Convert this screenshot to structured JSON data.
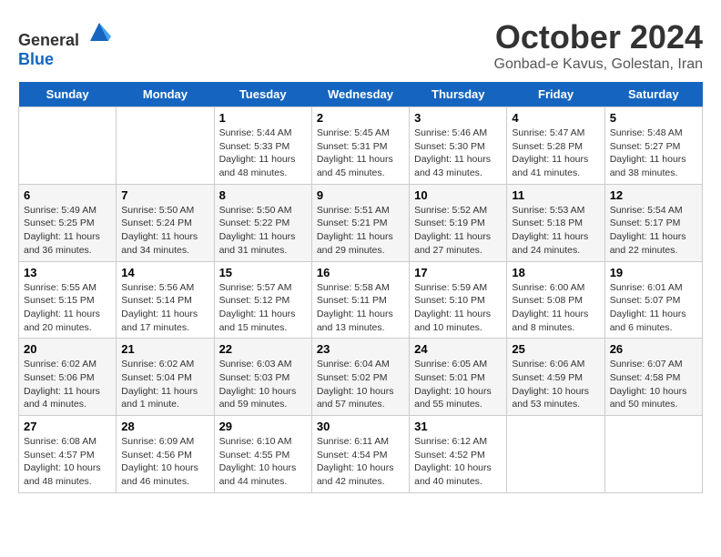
{
  "header": {
    "logo_general": "General",
    "logo_blue": "Blue",
    "month": "October 2024",
    "location": "Gonbad-e Kavus, Golestan, Iran"
  },
  "days_of_week": [
    "Sunday",
    "Monday",
    "Tuesday",
    "Wednesday",
    "Thursday",
    "Friday",
    "Saturday"
  ],
  "weeks": [
    [
      {
        "day": "",
        "sunrise": "",
        "sunset": "",
        "daylight": ""
      },
      {
        "day": "",
        "sunrise": "",
        "sunset": "",
        "daylight": ""
      },
      {
        "day": "1",
        "sunrise": "Sunrise: 5:44 AM",
        "sunset": "Sunset: 5:33 PM",
        "daylight": "Daylight: 11 hours and 48 minutes."
      },
      {
        "day": "2",
        "sunrise": "Sunrise: 5:45 AM",
        "sunset": "Sunset: 5:31 PM",
        "daylight": "Daylight: 11 hours and 45 minutes."
      },
      {
        "day": "3",
        "sunrise": "Sunrise: 5:46 AM",
        "sunset": "Sunset: 5:30 PM",
        "daylight": "Daylight: 11 hours and 43 minutes."
      },
      {
        "day": "4",
        "sunrise": "Sunrise: 5:47 AM",
        "sunset": "Sunset: 5:28 PM",
        "daylight": "Daylight: 11 hours and 41 minutes."
      },
      {
        "day": "5",
        "sunrise": "Sunrise: 5:48 AM",
        "sunset": "Sunset: 5:27 PM",
        "daylight": "Daylight: 11 hours and 38 minutes."
      }
    ],
    [
      {
        "day": "6",
        "sunrise": "Sunrise: 5:49 AM",
        "sunset": "Sunset: 5:25 PM",
        "daylight": "Daylight: 11 hours and 36 minutes."
      },
      {
        "day": "7",
        "sunrise": "Sunrise: 5:50 AM",
        "sunset": "Sunset: 5:24 PM",
        "daylight": "Daylight: 11 hours and 34 minutes."
      },
      {
        "day": "8",
        "sunrise": "Sunrise: 5:50 AM",
        "sunset": "Sunset: 5:22 PM",
        "daylight": "Daylight: 11 hours and 31 minutes."
      },
      {
        "day": "9",
        "sunrise": "Sunrise: 5:51 AM",
        "sunset": "Sunset: 5:21 PM",
        "daylight": "Daylight: 11 hours and 29 minutes."
      },
      {
        "day": "10",
        "sunrise": "Sunrise: 5:52 AM",
        "sunset": "Sunset: 5:19 PM",
        "daylight": "Daylight: 11 hours and 27 minutes."
      },
      {
        "day": "11",
        "sunrise": "Sunrise: 5:53 AM",
        "sunset": "Sunset: 5:18 PM",
        "daylight": "Daylight: 11 hours and 24 minutes."
      },
      {
        "day": "12",
        "sunrise": "Sunrise: 5:54 AM",
        "sunset": "Sunset: 5:17 PM",
        "daylight": "Daylight: 11 hours and 22 minutes."
      }
    ],
    [
      {
        "day": "13",
        "sunrise": "Sunrise: 5:55 AM",
        "sunset": "Sunset: 5:15 PM",
        "daylight": "Daylight: 11 hours and 20 minutes."
      },
      {
        "day": "14",
        "sunrise": "Sunrise: 5:56 AM",
        "sunset": "Sunset: 5:14 PM",
        "daylight": "Daylight: 11 hours and 17 minutes."
      },
      {
        "day": "15",
        "sunrise": "Sunrise: 5:57 AM",
        "sunset": "Sunset: 5:12 PM",
        "daylight": "Daylight: 11 hours and 15 minutes."
      },
      {
        "day": "16",
        "sunrise": "Sunrise: 5:58 AM",
        "sunset": "Sunset: 5:11 PM",
        "daylight": "Daylight: 11 hours and 13 minutes."
      },
      {
        "day": "17",
        "sunrise": "Sunrise: 5:59 AM",
        "sunset": "Sunset: 5:10 PM",
        "daylight": "Daylight: 11 hours and 10 minutes."
      },
      {
        "day": "18",
        "sunrise": "Sunrise: 6:00 AM",
        "sunset": "Sunset: 5:08 PM",
        "daylight": "Daylight: 11 hours and 8 minutes."
      },
      {
        "day": "19",
        "sunrise": "Sunrise: 6:01 AM",
        "sunset": "Sunset: 5:07 PM",
        "daylight": "Daylight: 11 hours and 6 minutes."
      }
    ],
    [
      {
        "day": "20",
        "sunrise": "Sunrise: 6:02 AM",
        "sunset": "Sunset: 5:06 PM",
        "daylight": "Daylight: 11 hours and 4 minutes."
      },
      {
        "day": "21",
        "sunrise": "Sunrise: 6:02 AM",
        "sunset": "Sunset: 5:04 PM",
        "daylight": "Daylight: 11 hours and 1 minute."
      },
      {
        "day": "22",
        "sunrise": "Sunrise: 6:03 AM",
        "sunset": "Sunset: 5:03 PM",
        "daylight": "Daylight: 10 hours and 59 minutes."
      },
      {
        "day": "23",
        "sunrise": "Sunrise: 6:04 AM",
        "sunset": "Sunset: 5:02 PM",
        "daylight": "Daylight: 10 hours and 57 minutes."
      },
      {
        "day": "24",
        "sunrise": "Sunrise: 6:05 AM",
        "sunset": "Sunset: 5:01 PM",
        "daylight": "Daylight: 10 hours and 55 minutes."
      },
      {
        "day": "25",
        "sunrise": "Sunrise: 6:06 AM",
        "sunset": "Sunset: 4:59 PM",
        "daylight": "Daylight: 10 hours and 53 minutes."
      },
      {
        "day": "26",
        "sunrise": "Sunrise: 6:07 AM",
        "sunset": "Sunset: 4:58 PM",
        "daylight": "Daylight: 10 hours and 50 minutes."
      }
    ],
    [
      {
        "day": "27",
        "sunrise": "Sunrise: 6:08 AM",
        "sunset": "Sunset: 4:57 PM",
        "daylight": "Daylight: 10 hours and 48 minutes."
      },
      {
        "day": "28",
        "sunrise": "Sunrise: 6:09 AM",
        "sunset": "Sunset: 4:56 PM",
        "daylight": "Daylight: 10 hours and 46 minutes."
      },
      {
        "day": "29",
        "sunrise": "Sunrise: 6:10 AM",
        "sunset": "Sunset: 4:55 PM",
        "daylight": "Daylight: 10 hours and 44 minutes."
      },
      {
        "day": "30",
        "sunrise": "Sunrise: 6:11 AM",
        "sunset": "Sunset: 4:54 PM",
        "daylight": "Daylight: 10 hours and 42 minutes."
      },
      {
        "day": "31",
        "sunrise": "Sunrise: 6:12 AM",
        "sunset": "Sunset: 4:52 PM",
        "daylight": "Daylight: 10 hours and 40 minutes."
      },
      {
        "day": "",
        "sunrise": "",
        "sunset": "",
        "daylight": ""
      },
      {
        "day": "",
        "sunrise": "",
        "sunset": "",
        "daylight": ""
      }
    ]
  ]
}
